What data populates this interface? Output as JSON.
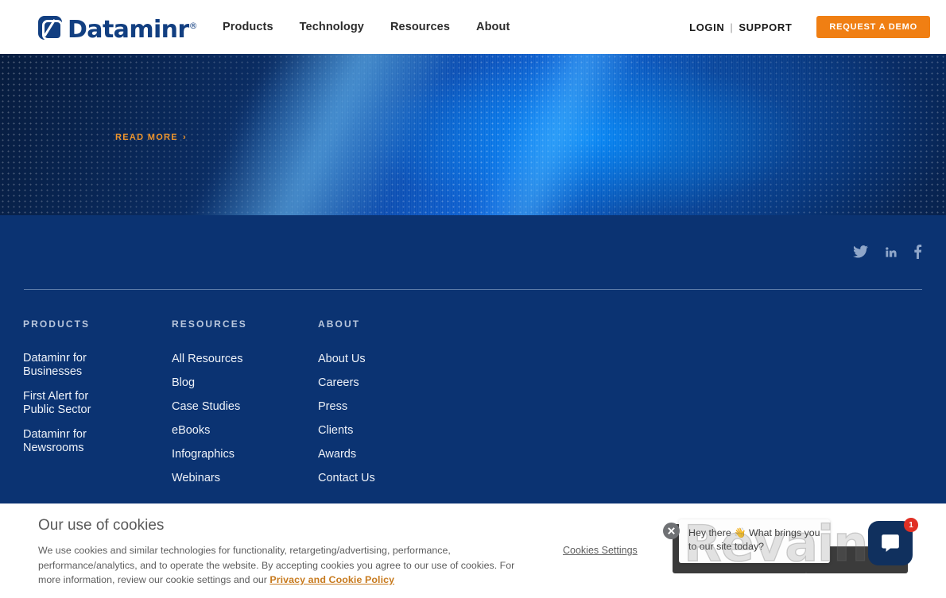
{
  "header": {
    "logo_text": "Dataminr",
    "logo_registered": "®",
    "nav": [
      {
        "label": "Products"
      },
      {
        "label": "Technology"
      },
      {
        "label": "Resources"
      },
      {
        "label": "About"
      }
    ],
    "login_label": "LOGIN",
    "divider": "|",
    "support_label": "SUPPORT",
    "demo_button": "REQUEST A DEMO",
    "accent_orange": "#f07f13",
    "brand_blue": "#123f81"
  },
  "hero": {
    "read_more_label": "READ MORE",
    "read_more_chevron": "›",
    "background_note": "dotted-wave-blue"
  },
  "footer": {
    "background": "#0b3372",
    "social": [
      {
        "name": "twitter-icon",
        "label": "Twitter"
      },
      {
        "name": "linkedin-icon",
        "label": "LinkedIn"
      },
      {
        "name": "facebook-icon",
        "label": "Facebook"
      }
    ],
    "columns": [
      {
        "title": "PRODUCTS",
        "links": [
          {
            "label": "Dataminr for Businesses"
          },
          {
            "label": "First Alert for Public Sector"
          },
          {
            "label": "Dataminr for Newsrooms"
          }
        ]
      },
      {
        "title": "RESOURCES",
        "links": [
          {
            "label": "All Resources"
          },
          {
            "label": "Blog"
          },
          {
            "label": "Case Studies"
          },
          {
            "label": "eBooks"
          },
          {
            "label": "Infographics"
          },
          {
            "label": "Webinars"
          }
        ]
      },
      {
        "title": "ABOUT",
        "links": [
          {
            "label": "About Us"
          },
          {
            "label": "Careers"
          },
          {
            "label": "Press"
          },
          {
            "label": "Clients"
          },
          {
            "label": "Awards"
          },
          {
            "label": "Contact Us"
          }
        ]
      }
    ]
  },
  "cookie_banner": {
    "title": "Our use of cookies",
    "body_part1": "We use cookies and similar technologies for functionality, retargeting/advertising, performance, performance/analytics, and to operate the website. By accepting cookies you agree to our use of cookies. For more information, review our cookie settings and our ",
    "policy_link": "Privacy and Cookie Policy",
    "settings_button": "Cookies Settings"
  },
  "chat_widget": {
    "message": "Hey there 👋 What brings you to our site today?",
    "badge_count": "1",
    "close_label": "×"
  },
  "watermark": {
    "text": "Revain"
  }
}
